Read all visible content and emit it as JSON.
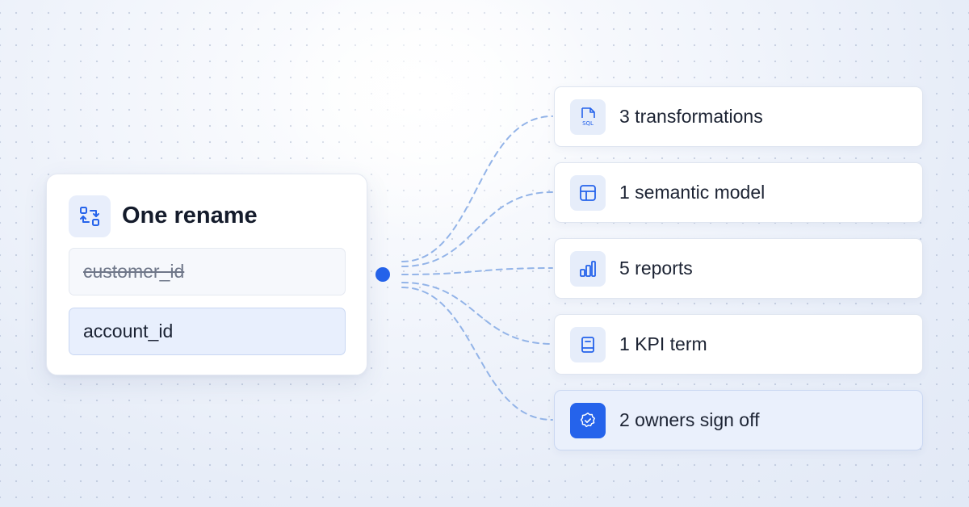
{
  "source": {
    "title": "One rename",
    "old_name": "customer_id",
    "new_name": "account_id",
    "icon": "swap-icon"
  },
  "impacts": [
    {
      "label": "3 transformations",
      "icon": "sql-file-icon"
    },
    {
      "label": "1 semantic model",
      "icon": "table-grid-icon"
    },
    {
      "label": "5 reports",
      "icon": "bar-chart-icon"
    },
    {
      "label": "1 KPI term",
      "icon": "glossary-book-icon"
    },
    {
      "label": "2 owners sign off",
      "icon": "verified-badge-icon"
    }
  ],
  "colors": {
    "accent": "#2563eb",
    "connector": "#93b4e8",
    "icon_bg": "#e6edfa",
    "highlight_bg": "#eaf0fc"
  }
}
